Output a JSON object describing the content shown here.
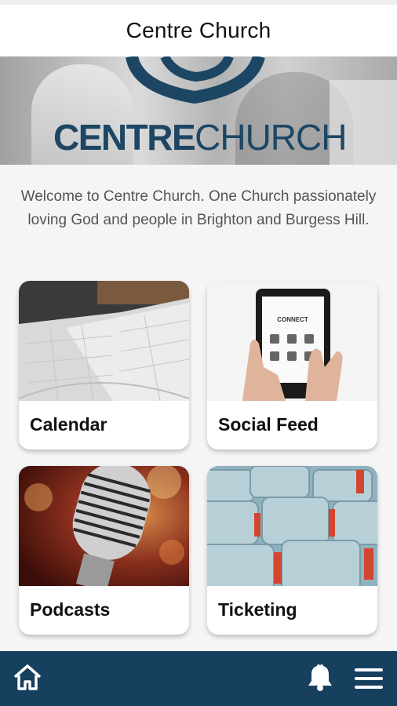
{
  "header": {
    "title": "Centre Church"
  },
  "banner": {
    "logo_word_bold": "CENTRE",
    "logo_word_light": "CHURCH"
  },
  "welcome": {
    "text": "Welcome to Centre Church. One Church passionately loving God and people in Brighton and Burgess Hill."
  },
  "tiles": [
    {
      "label": "Calendar",
      "icon": "calendar-photo"
    },
    {
      "label": "Social Feed",
      "icon": "tablet-photo"
    },
    {
      "label": "Podcasts",
      "icon": "microphone-photo"
    },
    {
      "label": "Ticketing",
      "icon": "seats-photo"
    }
  ],
  "tablet_screen": {
    "text": "CONNECT"
  },
  "bottom_nav": {
    "home_icon": "home-icon",
    "bell_icon": "bell-icon",
    "menu_icon": "menu-icon"
  },
  "colors": {
    "brand": "#17405f",
    "logo": "#1d4664",
    "background": "#f5f5f5"
  }
}
